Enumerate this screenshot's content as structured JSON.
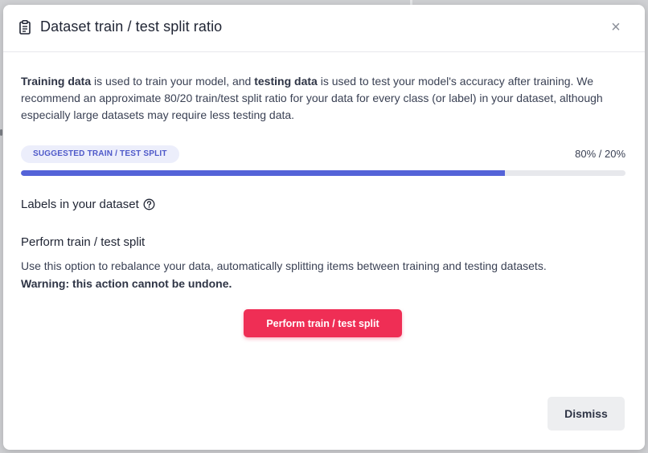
{
  "dialog": {
    "title": "Dataset train / test split ratio",
    "close_label": "×",
    "intro": {
      "bold_1": "Training data",
      "text_1": " is used to train your model, and ",
      "bold_2": "testing data",
      "text_2": " is used to test your model's accuracy after training. We recommend an approximate 80/20 train/test split ratio for your data for every class (or label) in your dataset, although especially large datasets may require less testing data."
    },
    "split": {
      "badge": "SUGGESTED TRAIN / TEST SPLIT",
      "value": "80% / 20%",
      "train_fraction": 0.8
    },
    "labels_heading": "Labels in your dataset",
    "perform_section": {
      "heading": "Perform train / test split",
      "description": "Use this option to rebalance your data, automatically splitting items between training and testing datasets.",
      "warning": "Warning: this action cannot be undone.",
      "button_label": "Perform train / test split"
    },
    "dismiss_label": "Dismiss"
  },
  "icons": {
    "header": "clipboard-icon",
    "help": "help-icon",
    "close": "close-icon"
  },
  "colors": {
    "accent": "#5463d8",
    "badge_bg": "#eceefb",
    "danger": "#ef2e55",
    "text": "#1f2433"
  }
}
